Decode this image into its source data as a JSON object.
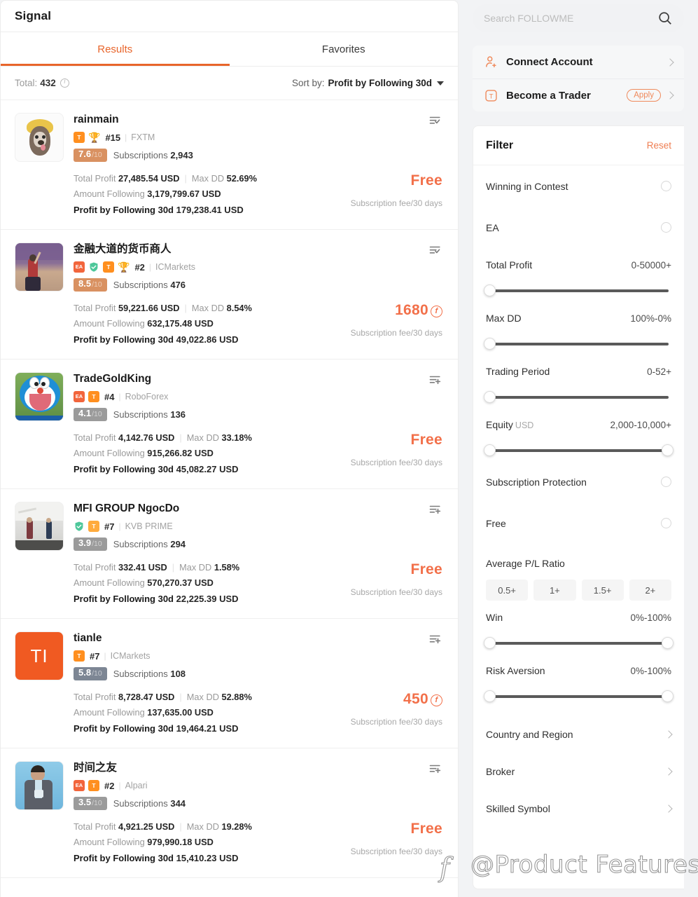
{
  "left": {
    "title": "Signal",
    "tabs": [
      {
        "label": "Results",
        "active": true
      },
      {
        "label": "Favorites",
        "active": false
      }
    ],
    "total_label": "Total:",
    "total_value": "432",
    "sort_prefix": "Sort by:",
    "sort_value": "Profit by Following 30d",
    "stat_labels": {
      "total_profit": "Total Profit",
      "max_dd": "Max DD",
      "amount_following": "Amount Following",
      "profit_following": "Profit by Following 30d",
      "subscriptions": "Subscriptions",
      "fee_note": "Subscription fee/30 days"
    },
    "traders": [
      {
        "name": "rainmain",
        "badges": [
          "T",
          "trophy"
        ],
        "rank": "#15",
        "broker": "FXTM",
        "score": "7.6",
        "score_den": "/10",
        "score_style": "orange",
        "subscriptions": "2,943",
        "total_profit": "27,485.54 USD",
        "max_dd": "52.69%",
        "amount_following": "3,179,799.67 USD",
        "profit_following": "179,238.41 USD",
        "price": "Free",
        "price_type": "free",
        "bookmarked": true,
        "avatar_kind": "dog"
      },
      {
        "name": "金融大道的货币商人",
        "badges": [
          "EA",
          "shield",
          "T",
          "trophy"
        ],
        "rank": "#2",
        "broker": "ICMarkets",
        "score": "8.5",
        "score_den": "/10",
        "score_style": "orange",
        "subscriptions": "476",
        "total_profit": "59,221.66 USD",
        "max_dd": "8.54%",
        "amount_following": "632,175.48 USD",
        "profit_following": "49,022.86 USD",
        "price": "1680",
        "price_type": "coin",
        "bookmarked": true,
        "avatar_kind": "purple"
      },
      {
        "name": "TradeGoldKing",
        "badges": [
          "EA",
          "T"
        ],
        "rank": "#4",
        "broker": "RoboForex",
        "score": "4.1",
        "score_den": "/10",
        "score_style": "gray",
        "subscriptions": "136",
        "total_profit": "4,142.76 USD",
        "max_dd": "33.18%",
        "amount_following": "915,266.82 USD",
        "profit_following": "45,082.27 USD",
        "price": "Free",
        "price_type": "free",
        "bookmarked": false,
        "avatar_kind": "doraemon"
      },
      {
        "name": "MFI GROUP NgocDo",
        "badges": [
          "shield",
          "T-light"
        ],
        "rank": "#7",
        "broker": "KVB PRIME",
        "score": "3.9",
        "score_den": "/10",
        "score_style": "gray",
        "subscriptions": "294",
        "total_profit": "332.41 USD",
        "max_dd": "1.58%",
        "amount_following": "570,270.37 USD",
        "profit_following": "22,225.39 USD",
        "price": "Free",
        "price_type": "free",
        "bookmarked": false,
        "avatar_kind": "office"
      },
      {
        "name": "tianle",
        "badges": [
          "T"
        ],
        "rank": "#7",
        "broker": "ICMarkets",
        "score": "5.8",
        "score_den": "/10",
        "score_style": "slate",
        "subscriptions": "108",
        "total_profit": "8,728.47 USD",
        "max_dd": "52.88%",
        "amount_following": "137,635.00 USD",
        "profit_following": "19,464.21 USD",
        "price": "450",
        "price_type": "coin",
        "bookmarked": false,
        "avatar_kind": "initials",
        "avatar_text": "TI"
      },
      {
        "name": "时间之友",
        "badges": [
          "EA",
          "T"
        ],
        "rank": "#2",
        "broker": "Alpari",
        "score": "3.5",
        "score_den": "/10",
        "score_style": "gray",
        "subscriptions": "344",
        "total_profit": "4,921.25 USD",
        "max_dd": "19.28%",
        "amount_following": "979,990.18 USD",
        "profit_following": "15,410.23 USD",
        "price": "Free",
        "price_type": "free",
        "bookmarked": false,
        "avatar_kind": "speaker"
      }
    ]
  },
  "right": {
    "search_placeholder": "Search FOLLOWME",
    "search_value": "",
    "accounts": [
      {
        "label": "Connect Account",
        "icon": "user-plus-icon",
        "pill": ""
      },
      {
        "label": "Become a Trader",
        "icon": "trader-t-icon",
        "pill": "Apply"
      }
    ],
    "filter": {
      "title": "Filter",
      "reset": "Reset",
      "toggles_top": [
        {
          "label": "Winning in Contest"
        },
        {
          "label": "EA"
        }
      ],
      "sliders_top": [
        {
          "label": "Total Profit",
          "range": "0-50000+",
          "handles": "left"
        },
        {
          "label": "Max DD",
          "range": "100%-0%",
          "handles": "left"
        },
        {
          "label": "Trading Period",
          "range": "0-52+",
          "handles": "left"
        },
        {
          "label": "Equity",
          "unit": "USD",
          "range": "2,000-10,000+",
          "handles": "both"
        }
      ],
      "toggles_mid": [
        {
          "label": "Subscription Protection"
        },
        {
          "label": "Free"
        }
      ],
      "pl_label": "Average P/L Ratio",
      "pl_options": [
        "0.5+",
        "1+",
        "1.5+",
        "2+"
      ],
      "sliders_bottom": [
        {
          "label": "Win",
          "range": "0%-100%",
          "handles": "both"
        },
        {
          "label": "Risk Aversion",
          "range": "0%-100%",
          "handles": "both"
        }
      ],
      "navs": [
        {
          "label": "Country and Region"
        },
        {
          "label": "Broker"
        },
        {
          "label": "Skilled Symbol"
        }
      ]
    }
  },
  "watermark": {
    "text": "@Product Features",
    "logo": "f"
  },
  "colors": {
    "accent": "#e8652b",
    "price": "#f2704a",
    "score_orange": "#d99161",
    "score_gray": "#9b9b9b",
    "score_slate": "#7d8694"
  }
}
